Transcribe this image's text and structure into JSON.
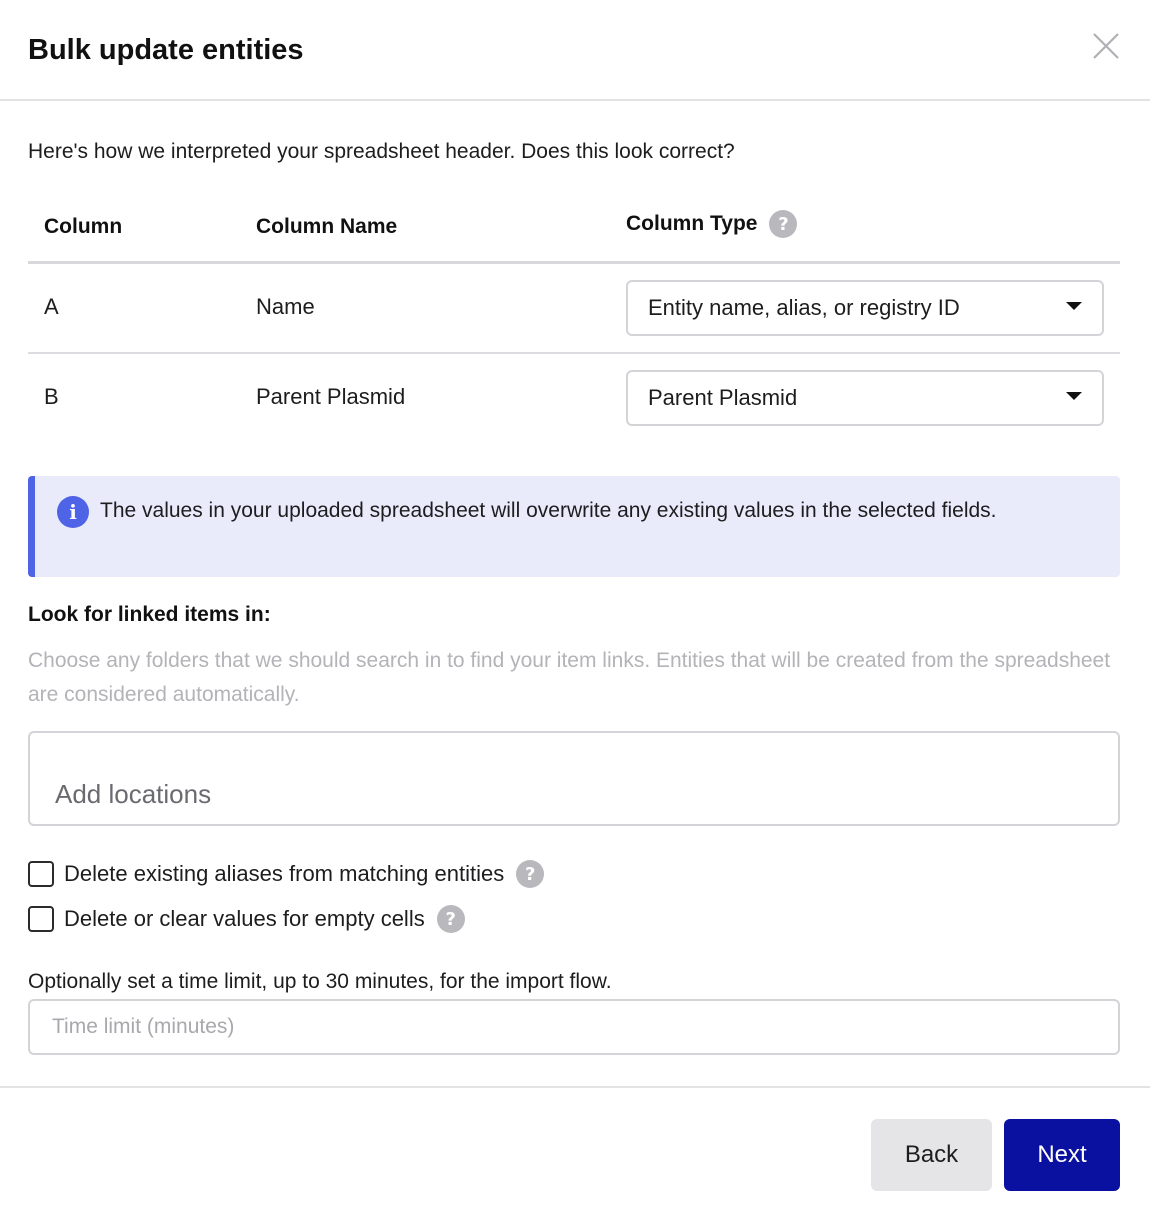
{
  "dialog": {
    "title": "Bulk update entities",
    "close_icon": "close-icon"
  },
  "intro": "Here's how we interpreted your spreadsheet header. Does this look correct?",
  "table": {
    "headers": [
      "Column",
      "Column Name",
      "Column Type"
    ],
    "help_glyph": "?",
    "rows": [
      {
        "column": "A",
        "name": "Name",
        "type": "Entity name, alias, or registry ID"
      },
      {
        "column": "B",
        "name": "Parent Plasmid",
        "type": "Parent Plasmid"
      }
    ]
  },
  "callout": {
    "icon": "info-icon",
    "icon_glyph": "i",
    "text": "The values in your uploaded spreadsheet will overwrite any existing values in the selected fields.",
    "accent": "#4e63e6"
  },
  "linked": {
    "title": "Look for linked items in:",
    "help": "Choose any folders that we should search in to find your item links. Entities that will be created from the spreadsheet are considered automatically.",
    "placeholder": "Add locations"
  },
  "options": [
    {
      "label": "Delete existing aliases from matching entities",
      "checked": false
    },
    {
      "label": "Delete or clear values for empty cells",
      "checked": false
    }
  ],
  "time_limit": {
    "label": "Optionally set a time limit, up to 30 minutes, for the import flow.",
    "placeholder": "Time limit (minutes)",
    "value": ""
  },
  "footer": {
    "back_label": "Back",
    "next_label": "Next",
    "primary_color": "#0a11a0"
  }
}
